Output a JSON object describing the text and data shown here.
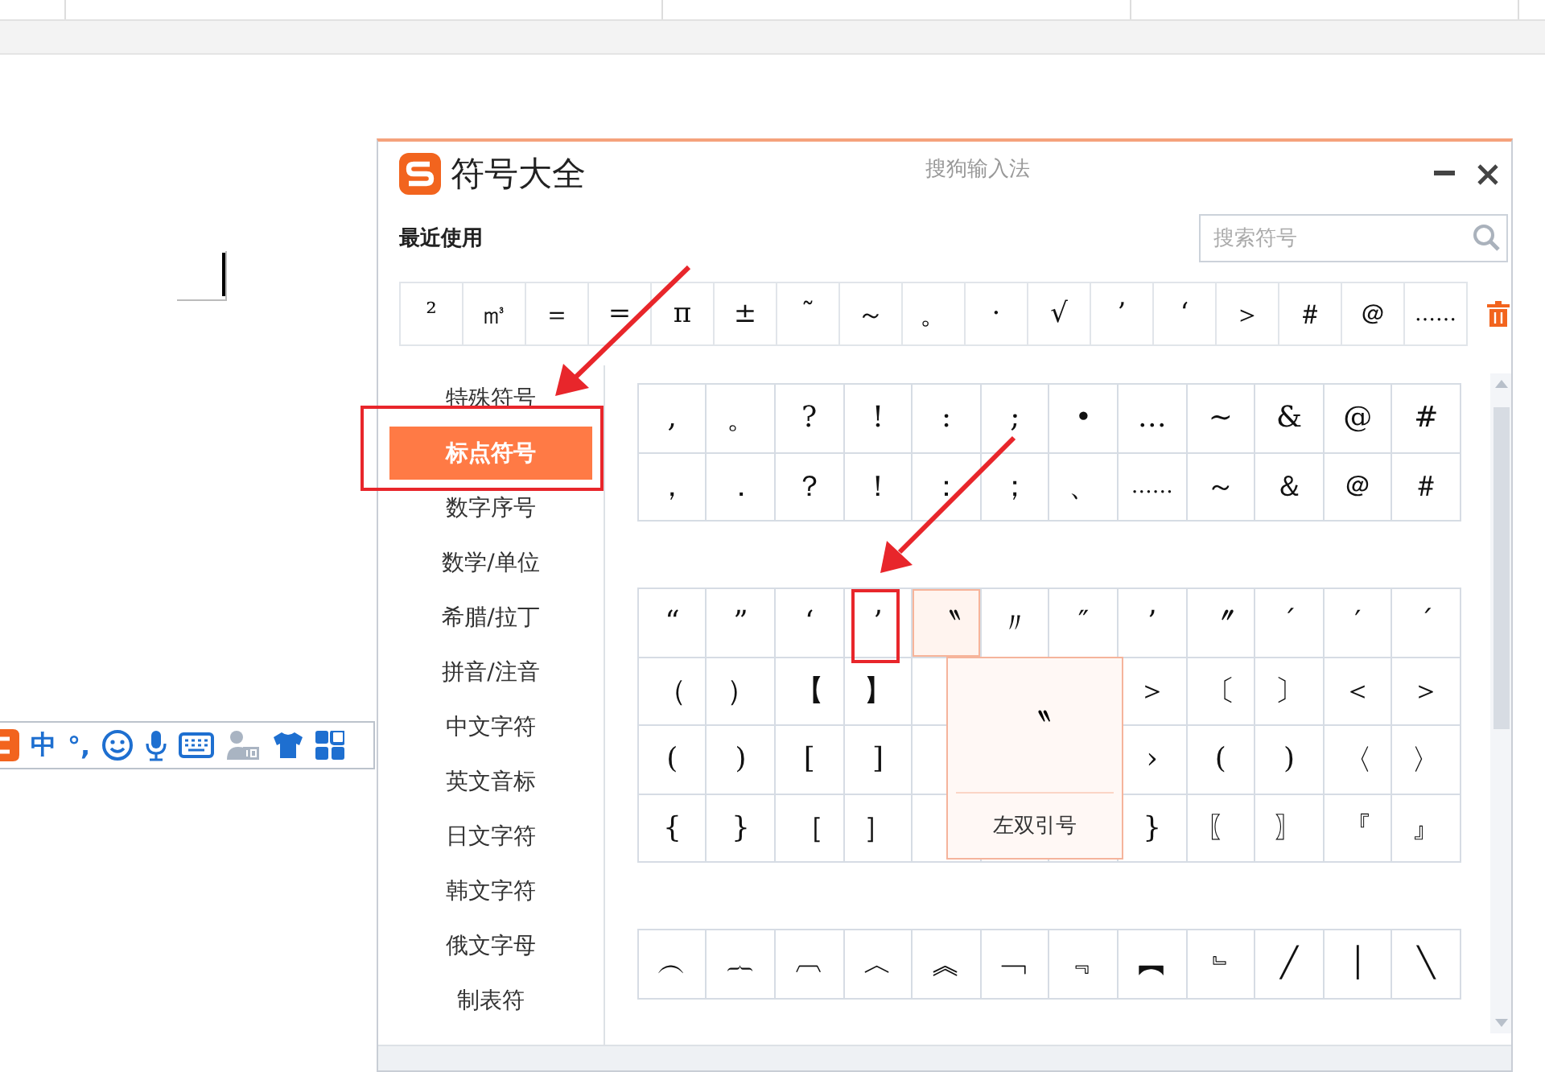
{
  "ime_toolbar": {
    "mode": "中",
    "punctuation": "°,"
  },
  "dialog": {
    "title": "符号大全",
    "app_name": "搜狗输入法",
    "recent_label": "最近使用",
    "search": {
      "placeholder": "搜索符号"
    },
    "recent": [
      "²",
      "㎥",
      "＝",
      "=",
      "π",
      "±",
      "˜",
      "～",
      "。",
      "·",
      "√",
      "’",
      "‘",
      "＞",
      "＃",
      "＠",
      "……"
    ],
    "categories": [
      {
        "label": "特殊符号",
        "selected": false
      },
      {
        "label": "标点符号",
        "selected": true
      },
      {
        "label": "数字序号",
        "selected": false
      },
      {
        "label": "数学/单位",
        "selected": false
      },
      {
        "label": "希腊/拉丁",
        "selected": false
      },
      {
        "label": "拼音/注音",
        "selected": false
      },
      {
        "label": "中文字符",
        "selected": false
      },
      {
        "label": "英文音标",
        "selected": false
      },
      {
        "label": "日文字符",
        "selected": false
      },
      {
        "label": "韩文字符",
        "selected": false
      },
      {
        "label": "俄文字母",
        "selected": false
      },
      {
        "label": "制表符",
        "selected": false
      }
    ],
    "groups": [
      {
        "rows": [
          [
            {
              "symbol": ",",
              "hovered": false
            },
            {
              "symbol": "。",
              "hovered": false
            },
            {
              "symbol": "?",
              "hovered": false
            },
            {
              "symbol": "!",
              "hovered": false
            },
            {
              "symbol": ":",
              "hovered": false
            },
            {
              "symbol": ";",
              "hovered": false
            },
            {
              "symbol": "•",
              "hovered": false
            },
            {
              "symbol": "…",
              "hovered": false
            },
            {
              "symbol": "~",
              "hovered": false
            },
            {
              "symbol": "&",
              "hovered": false
            },
            {
              "symbol": "@",
              "hovered": false
            },
            {
              "symbol": "#",
              "hovered": false
            }
          ],
          [
            {
              "symbol": "，",
              "hovered": false
            },
            {
              "symbol": "．",
              "hovered": false
            },
            {
              "symbol": "？",
              "hovered": false
            },
            {
              "symbol": "！",
              "hovered": false
            },
            {
              "symbol": "：",
              "hovered": false
            },
            {
              "symbol": "；",
              "hovered": false
            },
            {
              "symbol": "、",
              "hovered": false
            },
            {
              "symbol": "……",
              "hovered": false
            },
            {
              "symbol": "～",
              "hovered": false
            },
            {
              "symbol": "＆",
              "hovered": false
            },
            {
              "symbol": "＠",
              "hovered": false
            },
            {
              "symbol": "＃",
              "hovered": false
            }
          ]
        ]
      },
      {
        "rows": [
          [
            {
              "symbol": "“",
              "hovered": false
            },
            {
              "symbol": "”",
              "hovered": false
            },
            {
              "symbol": "‘",
              "hovered": false
            },
            {
              "symbol": "’",
              "hovered": false
            },
            {
              "symbol": "〝",
              "hovered": true
            },
            {
              "symbol": "〃",
              "hovered": false
            },
            {
              "symbol": "″",
              "hovered": false
            },
            {
              "symbol": "’",
              "hovered": false
            },
            {
              "symbol": "〞",
              "hovered": false
            },
            {
              "symbol": "ˊ",
              "hovered": false
            },
            {
              "symbol": "′",
              "hovered": false
            },
            {
              "symbol": "ˊ",
              "hovered": false
            }
          ],
          [
            {
              "symbol": "（",
              "hovered": false
            },
            {
              "symbol": "）",
              "hovered": false
            },
            {
              "symbol": "【",
              "hovered": false
            },
            {
              "symbol": "】",
              "hovered": false
            },
            null,
            null,
            null,
            {
              "symbol": "＞",
              "hovered": false
            },
            {
              "symbol": "〔",
              "hovered": false
            },
            {
              "symbol": "〕",
              "hovered": false
            },
            {
              "symbol": "＜",
              "hovered": false
            },
            {
              "symbol": "＞",
              "hovered": false
            }
          ],
          [
            {
              "symbol": "(",
              "hovered": false
            },
            {
              "symbol": ")",
              "hovered": false
            },
            {
              "symbol": "[",
              "hovered": false
            },
            {
              "symbol": "]",
              "hovered": false
            },
            null,
            null,
            null,
            {
              "symbol": "›",
              "hovered": false
            },
            {
              "symbol": "(",
              "hovered": false
            },
            {
              "symbol": ")",
              "hovered": false
            },
            {
              "symbol": "〈",
              "hovered": false
            },
            {
              "symbol": "〉",
              "hovered": false
            }
          ],
          [
            {
              "symbol": "{",
              "hovered": false
            },
            {
              "symbol": "}",
              "hovered": false
            },
            {
              "symbol": "［",
              "hovered": false
            },
            {
              "symbol": "］",
              "hovered": false
            },
            null,
            null,
            null,
            {
              "symbol": "}",
              "hovered": false
            },
            {
              "symbol": "〖",
              "hovered": false
            },
            {
              "symbol": "〗",
              "hovered": false
            },
            {
              "symbol": "『",
              "hovered": false
            },
            {
              "symbol": "』",
              "hovered": false
            }
          ]
        ]
      },
      {
        "rows": [
          [
            {
              "symbol": "︵",
              "hovered": false
            },
            {
              "symbol": "︷",
              "hovered": false
            },
            {
              "symbol": "︹",
              "hovered": false
            },
            {
              "symbol": "︿",
              "hovered": false
            },
            {
              "symbol": "︽",
              "hovered": false
            },
            {
              "symbol": "﹁",
              "hovered": false
            },
            {
              "symbol": "﹃",
              "hovered": false
            },
            {
              "symbol": "︻",
              "hovered": false
            },
            {
              "symbol": "﹄",
              "hovered": false
            },
            {
              "symbol": "╱",
              "hovered": false
            },
            {
              "symbol": "│",
              "hovered": false
            },
            {
              "symbol": "╲",
              "hovered": false
            }
          ]
        ]
      }
    ],
    "tooltip": {
      "symbol": "〝",
      "name": "左双引号"
    }
  }
}
